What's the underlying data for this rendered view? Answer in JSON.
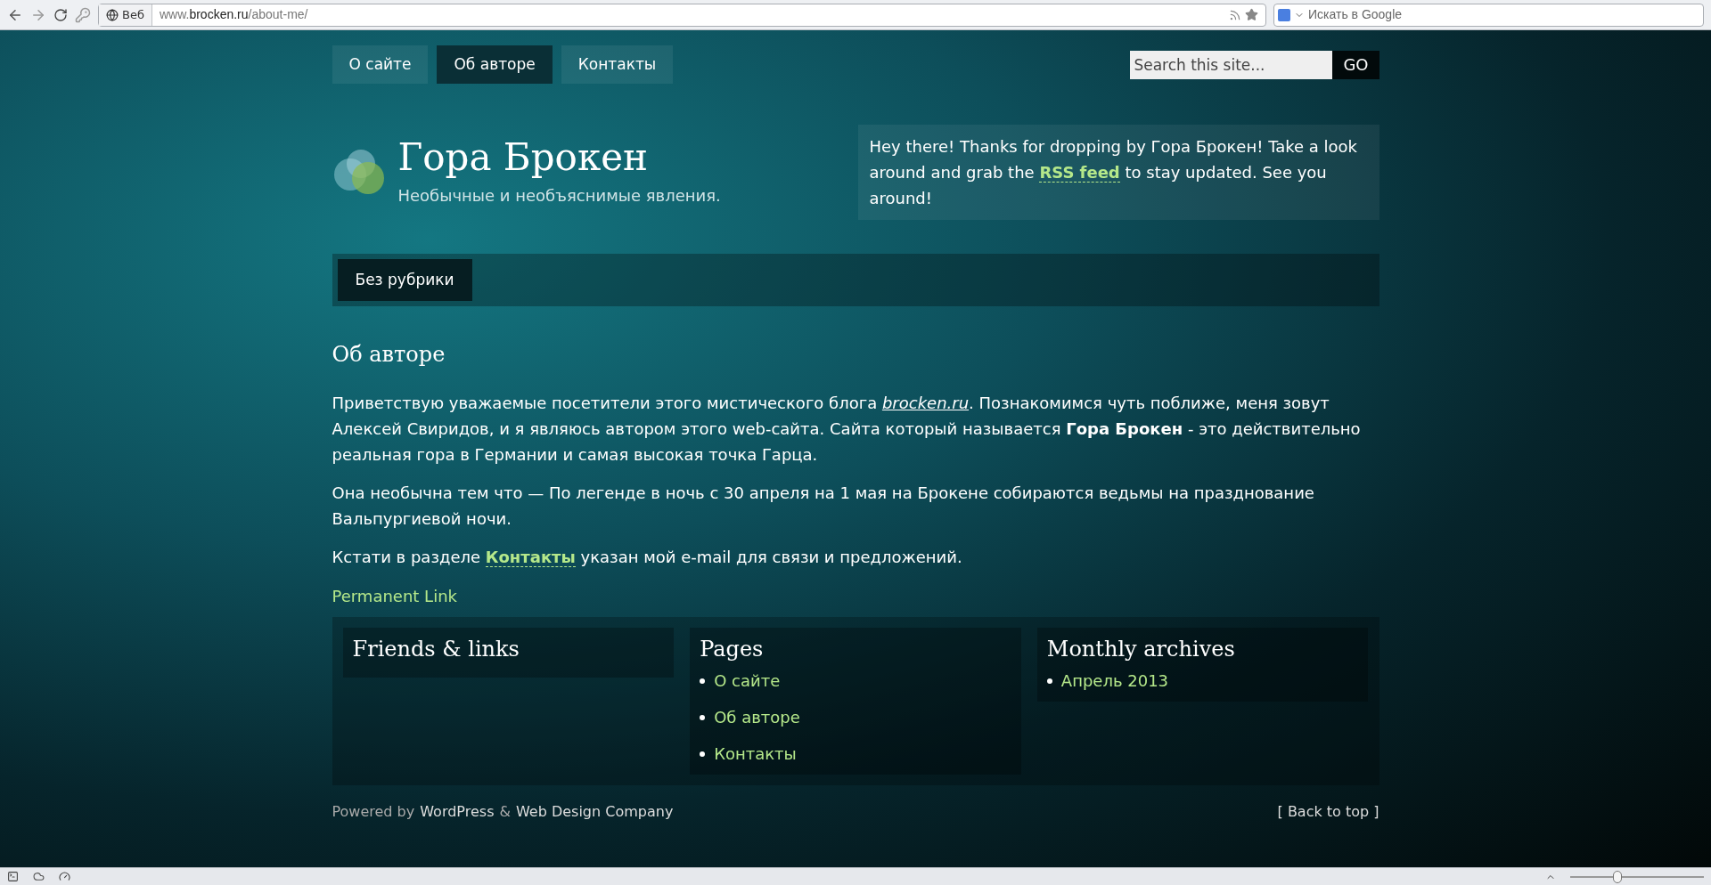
{
  "browser": {
    "site_chip": "Веб",
    "address": {
      "prefix": "www.",
      "host": "brocken.ru",
      "path": "/about-me/"
    },
    "search": {
      "placeholder": "Искать в Google"
    }
  },
  "nav": {
    "tabs": [
      {
        "label": "О сайте",
        "selected": false
      },
      {
        "label": "Об авторе",
        "selected": true
      },
      {
        "label": "Контакты",
        "selected": false
      }
    ],
    "search": {
      "placeholder": "Search this site...",
      "button": "GO"
    }
  },
  "header": {
    "title": "Гора Брокен",
    "tagline": "Необычные и необъяснимые явления.",
    "welcome": [
      {
        "kind": "text",
        "text": "Hey there! Thanks for dropping by Гора Брокен! Take a look around and grab the "
      },
      {
        "kind": "link",
        "text": "RSS feed"
      },
      {
        "kind": "text",
        "text": " to stay updated. See you around!"
      }
    ]
  },
  "categories": [
    {
      "label": "Без рубрики"
    }
  ],
  "article": {
    "title": "Об авторе",
    "paragraphs": [
      [
        {
          "kind": "text",
          "text": "Приветствую уважаемые посетители этого мистического блога "
        },
        {
          "kind": "italic_link",
          "text": "brocken.ru"
        },
        {
          "kind": "text",
          "text": ". Познакомимся чуть поближе, меня зовут Алексей Свиридов, и я являюсь автором этого web-сайта. Сайта который называется **Гора Брокен** - это действительно реальная гора в Германии и самая высокая точка Гарца."
        }
      ],
      [
        {
          "kind": "text",
          "text": "Она необычна тем что — По легенде в ночь с 30 апреля на 1 мая на Брокене собираются ведьмы на празднование Вальпургиевой ночи."
        }
      ],
      [
        {
          "kind": "text",
          "text": "Кстати в разделе "
        },
        {
          "kind": "link",
          "text": "Контакты"
        },
        {
          "kind": "text",
          "text": " указан мой e-mail для связи и предложений."
        }
      ]
    ],
    "permalink": "Permanent Link"
  },
  "widgets": [
    {
      "title": "Friends & links"
    },
    {
      "title": "Pages",
      "items": [
        "О сайте",
        "Об авторе",
        "Контакты"
      ]
    },
    {
      "title": "Monthly archives",
      "items": [
        "Апрель 2013"
      ]
    }
  ],
  "footer": {
    "powered": "Powered by",
    "wordpress": "WordPress",
    "amp": "&",
    "company": "Web Design Company",
    "back_to_top": "[ Back to top ]"
  },
  "status_bar": {
    "zoom": {
      "level": 0.35
    }
  }
}
